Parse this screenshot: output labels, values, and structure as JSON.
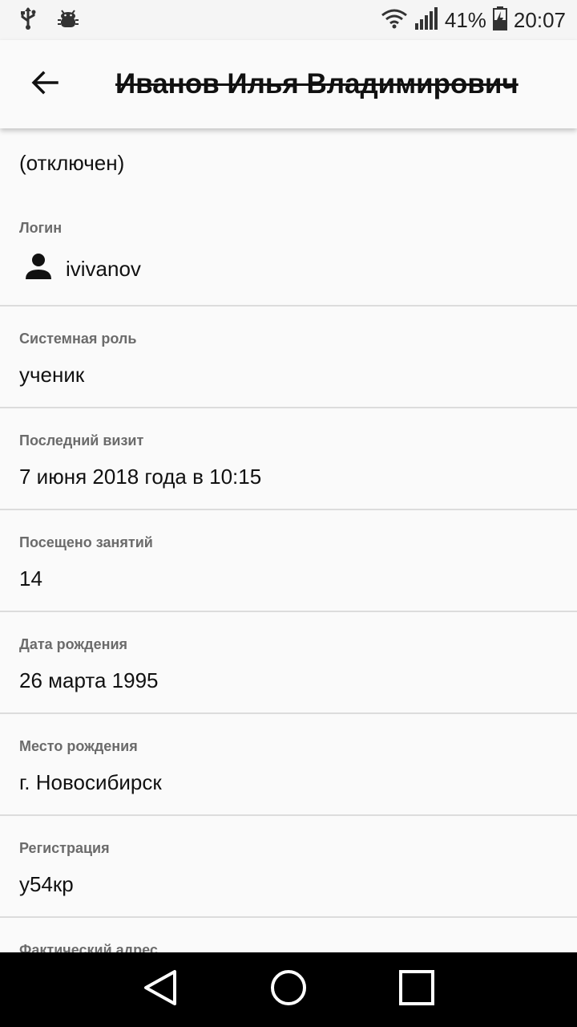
{
  "status_bar": {
    "icons_left": [
      "usb-icon",
      "android-debug-icon"
    ],
    "battery_percent": "41%",
    "time": "20:07"
  },
  "app_bar": {
    "title": "Иванов Илья Владимирович"
  },
  "profile": {
    "disabled_note": "(отключен)",
    "login": {
      "label": "Логин",
      "value": "ivivanov"
    },
    "role": {
      "label": "Системная роль",
      "value": "ученик"
    },
    "last_visit": {
      "label": "Последний визит",
      "value": "7 июня 2018 года в 10:15"
    },
    "lessons": {
      "label": "Посещено занятий",
      "value": "14"
    },
    "birth_date": {
      "label": "Дата рождения",
      "value": "26 марта 1995"
    },
    "birth_place": {
      "label": "Место рождения",
      "value": "г. Новосибирск"
    },
    "registration": {
      "label": "Регистрация",
      "value": "у54кр"
    },
    "actual_address": {
      "label": "Фактический адрес"
    }
  }
}
